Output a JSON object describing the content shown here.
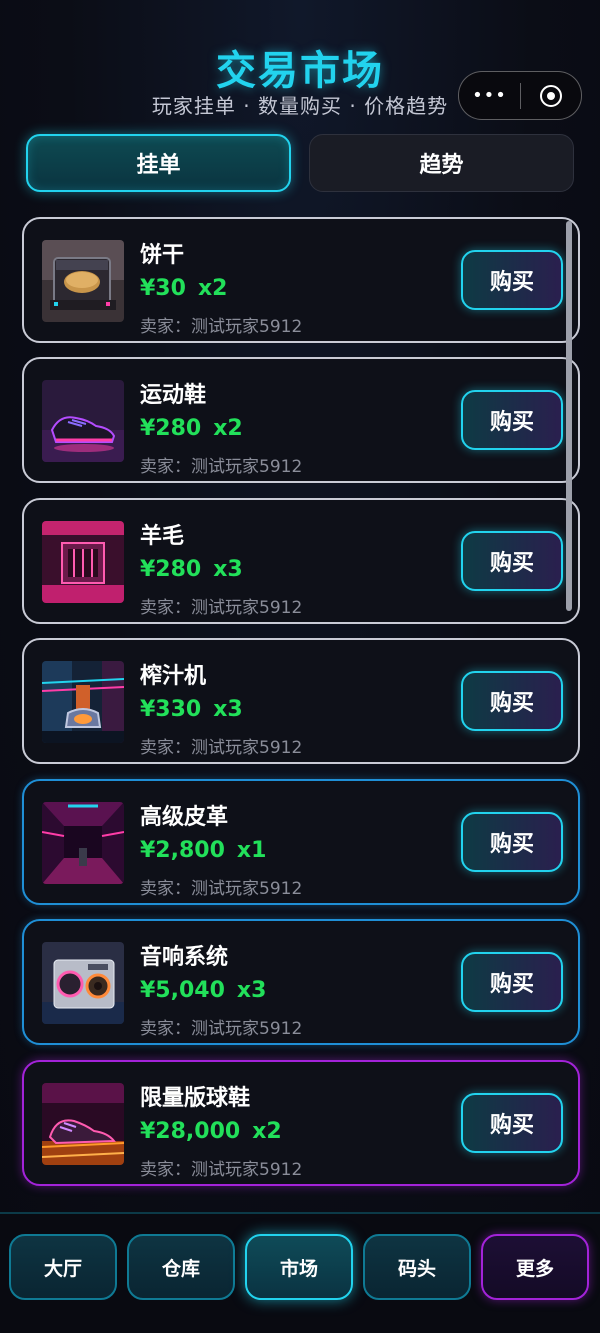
{
  "header": {
    "title": "交易市场",
    "subtitle": "玩家挂单 · 数量购买 · 价格趋势"
  },
  "capsule": {
    "more_icon": "more-dots-icon",
    "more_label": "•••",
    "close_icon": "target-circle-icon"
  },
  "tabs": [
    {
      "label": "挂单",
      "active": true
    },
    {
      "label": "趋势",
      "active": false
    }
  ],
  "listings": [
    {
      "name": "饼干",
      "price": "¥30",
      "qty": "x2",
      "seller": "卖家：测试玩家5912",
      "buy_label": "购买",
      "rarity": "white",
      "image": "cookie-box-image"
    },
    {
      "name": "运动鞋",
      "price": "¥280",
      "qty": "x2",
      "seller": "卖家：测试玩家5912",
      "buy_label": "购买",
      "rarity": "white",
      "image": "sneaker-image"
    },
    {
      "name": "羊毛",
      "price": "¥280",
      "qty": "x3",
      "seller": "卖家：测试玩家5912",
      "buy_label": "购买",
      "rarity": "white",
      "image": "neon-room-image"
    },
    {
      "name": "榨汁机",
      "price": "¥330",
      "qty": "x3",
      "seller": "卖家：测试玩家5912",
      "buy_label": "购买",
      "rarity": "white",
      "image": "juicer-image"
    },
    {
      "name": "高级皮革",
      "price": "¥2,800",
      "qty": "x1",
      "seller": "卖家：测试玩家5912",
      "buy_label": "购买",
      "rarity": "blue",
      "image": "neon-corridor-image"
    },
    {
      "name": "音响系统",
      "price": "¥5,040",
      "qty": "x3",
      "seller": "卖家：测试玩家5912",
      "buy_label": "购买",
      "rarity": "blue",
      "image": "speaker-image"
    },
    {
      "name": "限量版球鞋",
      "price": "¥28,000",
      "qty": "x2",
      "seller": "卖家：测试玩家5912",
      "buy_label": "购买",
      "rarity": "purple",
      "image": "limited-sneaker-image"
    }
  ],
  "bottom_nav": [
    {
      "label": "大厅",
      "state": "normal"
    },
    {
      "label": "仓库",
      "state": "normal"
    },
    {
      "label": "市场",
      "state": "active"
    },
    {
      "label": "码头",
      "state": "normal"
    },
    {
      "label": "更多",
      "state": "more"
    }
  ],
  "colors": {
    "accent": "#22d3ee",
    "price": "#22e05a",
    "rarity_white": "#c9cbd6",
    "rarity_blue": "#1f8fd6",
    "rarity_purple": "#a323d9",
    "background": "#0b0d16"
  }
}
